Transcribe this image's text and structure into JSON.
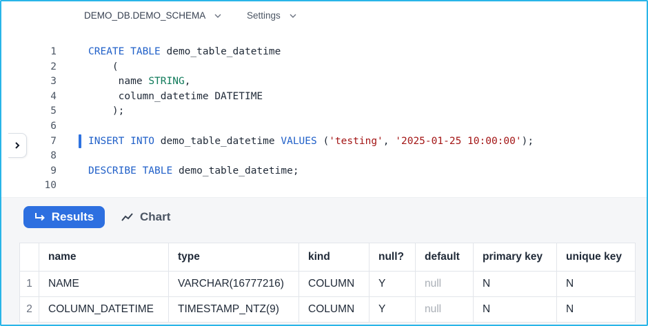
{
  "breadcrumb": {
    "database_schema": "DEMO_DB.DEMO_SCHEMA",
    "settings": "Settings"
  },
  "editor": {
    "line_numbers": [
      "1",
      "2",
      "3",
      "4",
      "5",
      "6",
      "7",
      "8",
      "9",
      "10"
    ],
    "lines": [
      {
        "tokens": [
          {
            "t": "CREATE TABLE",
            "c": "kw"
          },
          {
            "t": " demo_table_datetime",
            "c": ""
          }
        ]
      },
      {
        "tokens": [
          {
            "t": "    (",
            "c": ""
          }
        ]
      },
      {
        "tokens": [
          {
            "t": "     name ",
            "c": ""
          },
          {
            "t": "STRING",
            "c": "ty"
          },
          {
            "t": ",",
            "c": ""
          }
        ]
      },
      {
        "tokens": [
          {
            "t": "     column_datetime DATETIME",
            "c": ""
          }
        ]
      },
      {
        "tokens": [
          {
            "t": "    );",
            "c": ""
          }
        ]
      },
      {
        "tokens": []
      },
      {
        "tokens": [
          {
            "t": "INSERT INTO",
            "c": "kw"
          },
          {
            "t": " demo_table_datetime ",
            "c": ""
          },
          {
            "t": "VALUES",
            "c": "kw"
          },
          {
            "t": " (",
            "c": ""
          },
          {
            "t": "'testing'",
            "c": "str"
          },
          {
            "t": ", ",
            "c": ""
          },
          {
            "t": "'2025-01-25 10:00:00'",
            "c": "str"
          },
          {
            "t": ");",
            "c": ""
          }
        ]
      },
      {
        "tokens": []
      },
      {
        "tokens": [
          {
            "t": "DESCRIBE TABLE",
            "c": "kw"
          },
          {
            "t": " demo_table_datetime;",
            "c": ""
          }
        ]
      },
      {
        "tokens": []
      }
    ]
  },
  "tabs": {
    "results": "Results",
    "chart": "Chart"
  },
  "icons": {
    "results": "return-arrow-icon",
    "chart": "line-chart-icon",
    "sidebar_toggle": "chevron-right-icon",
    "dropdown": "chevron-down-icon"
  },
  "colors": {
    "accent": "#2d6fe0",
    "frame": "#29b5e8",
    "keyword": "#1f5fc8",
    "type": "#0f7a5a",
    "string": "#a31515"
  },
  "table": {
    "columns": [
      "name",
      "type",
      "kind",
      "null?",
      "default",
      "primary key",
      "unique key"
    ],
    "rows": [
      {
        "index": "1",
        "cells": [
          "NAME",
          "VARCHAR(16777216)",
          "COLUMN",
          "Y",
          "null",
          "N",
          "N"
        ]
      },
      {
        "index": "2",
        "cells": [
          "COLUMN_DATETIME",
          "TIMESTAMP_NTZ(9)",
          "COLUMN",
          "Y",
          "null",
          "N",
          "N"
        ]
      }
    ]
  }
}
